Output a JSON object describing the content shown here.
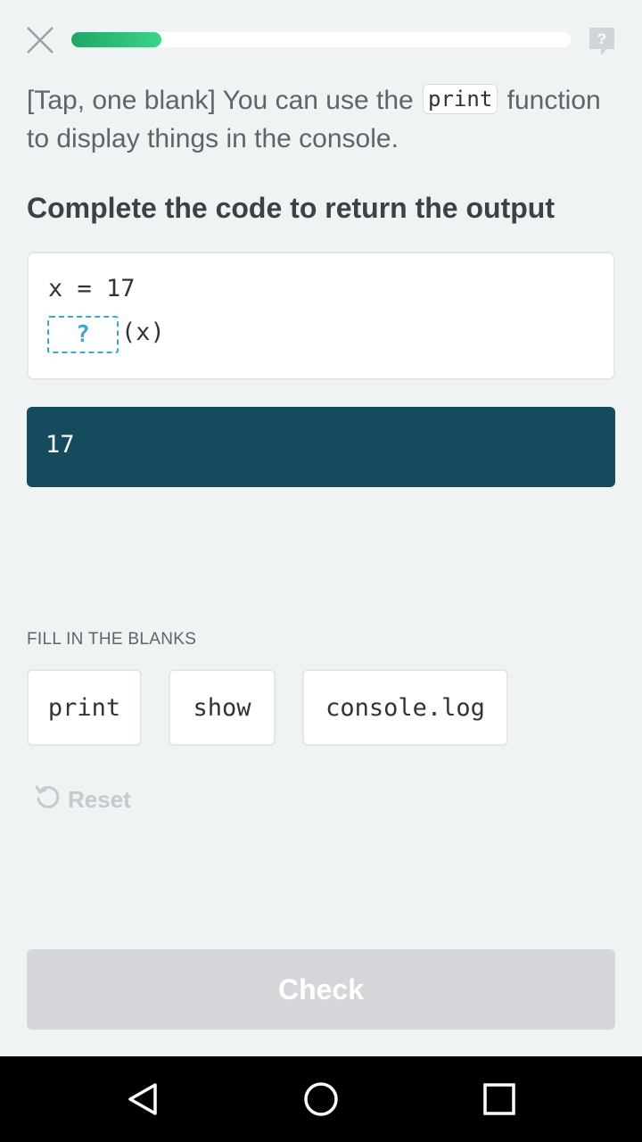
{
  "header": {
    "progress": 0.18,
    "close_icon": "close-icon",
    "help_icon": "help-icon",
    "help_glyph": "?"
  },
  "instruction": {
    "before": "[Tap, one blank] You can use the ",
    "code": "print",
    "after": " function to display things in the console."
  },
  "heading": "Complete the code to return the output",
  "code": {
    "line1": "x = 17",
    "blank_placeholder": "?",
    "line2_suffix": "(x)"
  },
  "output": "17",
  "options": {
    "label": "FILL IN THE BLANKS",
    "items": [
      "print",
      "show",
      "console.log"
    ]
  },
  "reset_label": "Reset",
  "check_label": "Check",
  "colors": {
    "background": "#eff3f4",
    "progress": "#2ecc80",
    "blank": "#3aa9cc",
    "output_bg": "#144c5e",
    "check_disabled": "#d4d6da"
  }
}
